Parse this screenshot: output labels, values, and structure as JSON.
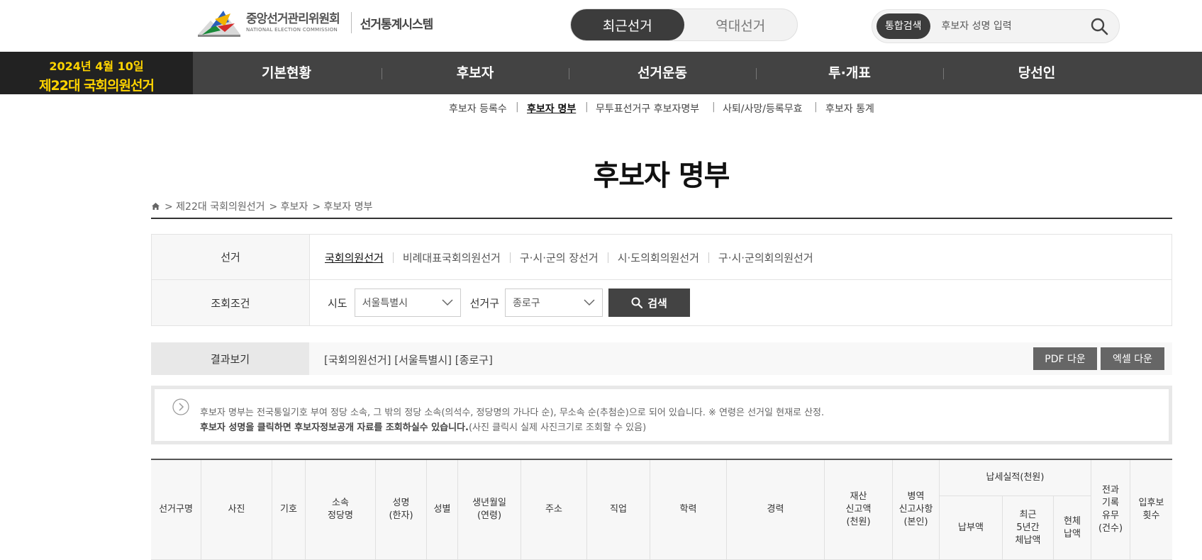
{
  "header": {
    "org_name": "중앙선거관리위원회",
    "org_name_en": "NATIONAL ELECTION COMMISSION",
    "system_name": "선거통계시스템",
    "toggle": [
      "최근선거",
      "역대선거"
    ],
    "search": {
      "tag": "통합검색",
      "placeholder": "후보자 성명 입력"
    }
  },
  "gnb": {
    "date": "2024년 4월 10일",
    "election": "제22대 국회의원선거",
    "items": [
      "기본현황",
      "후보자",
      "선거운동",
      "투·개표",
      "당선인"
    ]
  },
  "submenu": [
    "후보자 등록수",
    "후보자 명부",
    "무투표선거구 후보자명부",
    "사퇴/사망/등록무효",
    "후보자 통계"
  ],
  "page_title": "후보자 명부",
  "breadcrumb": [
    "> 제22대 국회의원선거",
    "> 후보자",
    "> 후보자 명부"
  ],
  "filter": {
    "election_label": "선거",
    "election_tabs": [
      "국회의원선거",
      "비례대표국회의원선거",
      "구·시·군의 장선거",
      "시·도의회의원선거",
      "구·시·군의회의원선거"
    ],
    "condition_label": "조회조건",
    "sido_label": "시도",
    "sido_value": "서울특별시",
    "district_label": "선거구",
    "district_value": "종로구",
    "search_button": "검색"
  },
  "result": {
    "label": "결과보기",
    "text": "[국회의원선거]  [서울특별시]  [종로구]",
    "pdf_button": "PDF 다운",
    "excel_button": "엑셀 다운"
  },
  "notice": {
    "line1": "후보자 명부는 전국통일기호 부여 정당 소속, 그 밖의 정당 소속(의석수, 정당명의 가나다 순), 무소속 순(추첨순)으로 되어 있습니다. ※ 연령은 선거일 현재로 산정.",
    "line2_bold": "후보자 성명을 클릭하면 후보자정보공개 자료를 조회하실수 있습니다.",
    "line2_rest": "(사진 클릭시 실제 사진크기로 조회할 수 있음)"
  },
  "table": {
    "headers": [
      "선거구명",
      "사진",
      "기호",
      "소속\n정당명",
      "성명\n(한자)",
      "성별",
      "생년월일\n(연령)",
      "주소",
      "직업",
      "학력",
      "경력",
      "재산\n신고액\n(천원)",
      "병역\n신고사항\n(본인)"
    ],
    "tax_group": "납세실적(천원)",
    "tax_headers": [
      "납부액",
      "최근\n5년간\n체납액",
      "현체\n납액"
    ],
    "tail_headers": [
      "전과\n기록\n유무\n(건수)",
      "입후보\n횟수"
    ]
  },
  "colors": {
    "accent_yellow": "#ffd400",
    "gnb_bg": "#434343",
    "dark": "#222222"
  }
}
